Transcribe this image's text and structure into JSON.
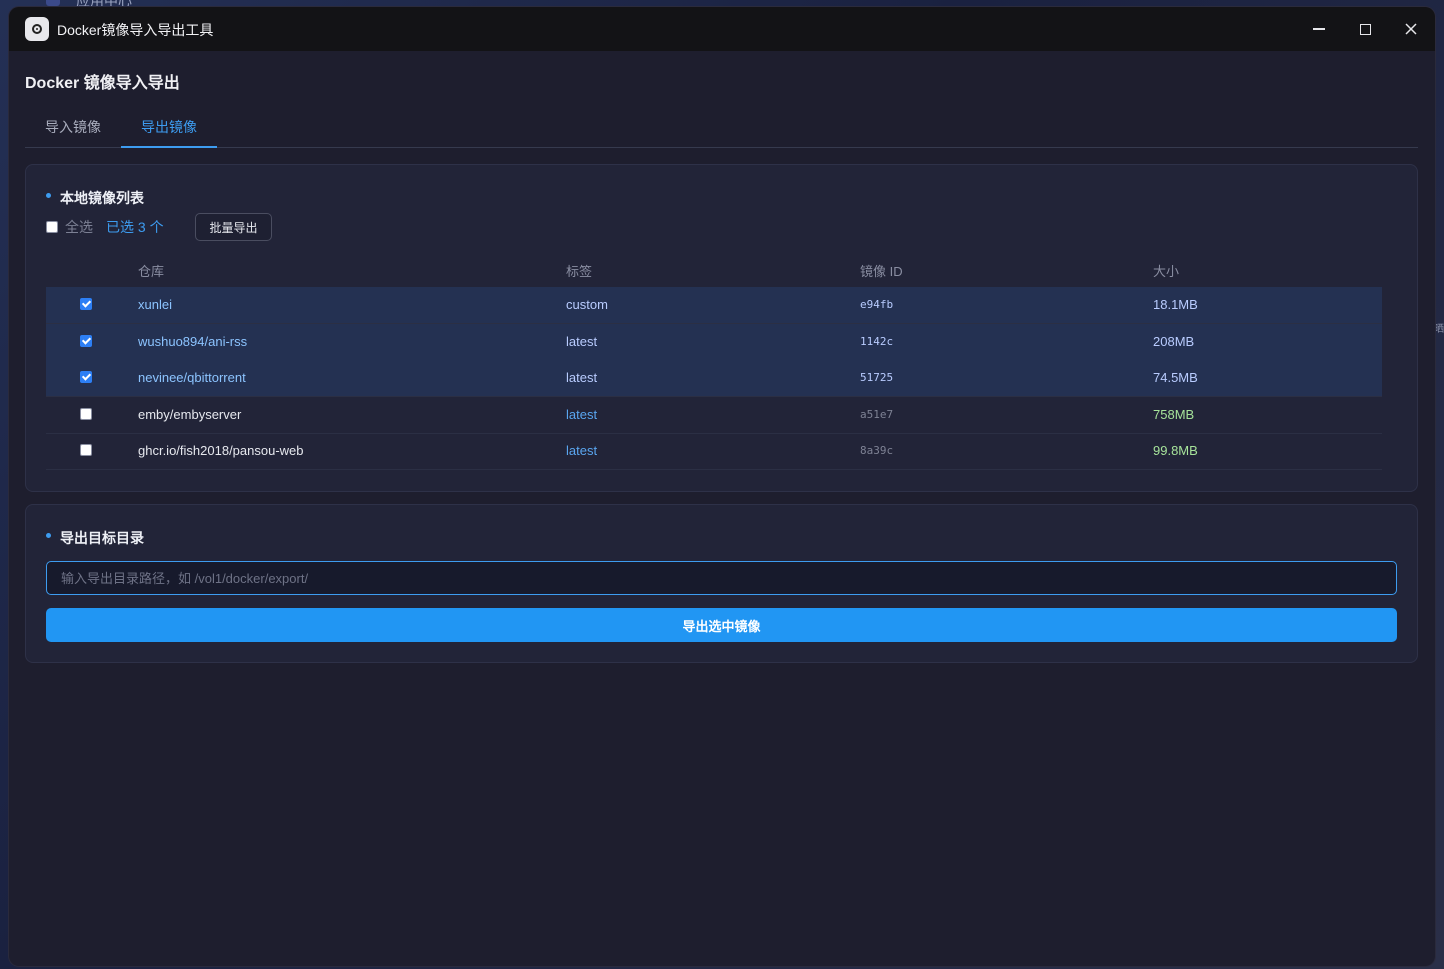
{
  "background": {
    "app_label": "应用中心",
    "edge_glyph": "晒"
  },
  "window": {
    "title": "Docker镜像导入导出工具",
    "controls": {
      "minimize": "minimize",
      "maximize": "maximize",
      "close": "close"
    }
  },
  "page": {
    "title": "Docker 镜像导入导出"
  },
  "tabs": [
    {
      "label": "导入镜像",
      "active": false
    },
    {
      "label": "导出镜像",
      "active": true
    }
  ],
  "image_list": {
    "section_title": "本地镜像列表",
    "select_all_label": "全选",
    "select_all_checked": false,
    "selected_count_text": "已选 3 个",
    "batch_export_label": "批量导出",
    "columns": [
      "仓库",
      "标签",
      "镜像 ID",
      "大小"
    ],
    "rows": [
      {
        "checked": true,
        "repo": "xunlei",
        "tag": "custom",
        "id": "e94fb",
        "size": "18.1MB"
      },
      {
        "checked": true,
        "repo": "wushuo894/ani-rss",
        "tag": "latest",
        "id": "1142c",
        "size": "208MB"
      },
      {
        "checked": true,
        "repo": "nevinee/qbittorrent",
        "tag": "latest",
        "id": "51725",
        "size": "74.5MB"
      },
      {
        "checked": false,
        "repo": "emby/embyserver",
        "tag": "latest",
        "id": "a51e7",
        "size": "758MB"
      },
      {
        "checked": false,
        "repo": "ghcr.io/fish2018/pansou-web",
        "tag": "latest",
        "id": "8a39c",
        "size": "99.8MB"
      }
    ]
  },
  "export": {
    "section_title": "导出目标目录",
    "path_value": "",
    "path_placeholder": "输入导出目录路径，如 /vol1/docker/export/",
    "submit_label": "导出选中镜像"
  },
  "colors": {
    "accent": "#3d9cf0",
    "button_primary": "#2196f3",
    "selected_row": "#243152",
    "size_green": "#a6e39a"
  }
}
